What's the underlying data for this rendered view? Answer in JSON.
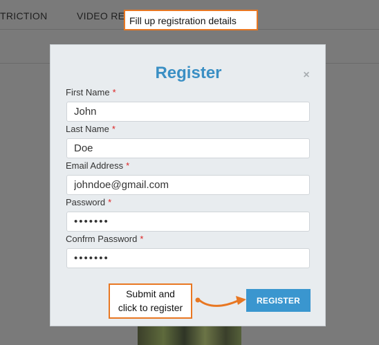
{
  "background": {
    "nav_items": [
      "TRICTION",
      "VIDEO REV"
    ]
  },
  "modal": {
    "title": "Register",
    "close_glyph": "×",
    "fields": [
      {
        "label": "First Name",
        "required_mark": "*",
        "value": "John"
      },
      {
        "label": "Last Name",
        "required_mark": "*",
        "value": "Doe"
      },
      {
        "label": "Email Address",
        "required_mark": "*",
        "value": "johndoe@gmail.com"
      },
      {
        "label": "Password",
        "required_mark": "*",
        "value": "•••••••"
      },
      {
        "label": "Confrm Password",
        "required_mark": "*",
        "value": "•••••••"
      }
    ],
    "register_label": "REGISTER"
  },
  "annotations": {
    "top_callout": "Fill up registration details",
    "submit_callout_line1": "Submit and",
    "submit_callout_line2": "click to register"
  },
  "colors": {
    "accent": "#3a96cf",
    "title": "#3a8fc4",
    "annotation_border": "#e87722",
    "required": "#dd2222"
  }
}
